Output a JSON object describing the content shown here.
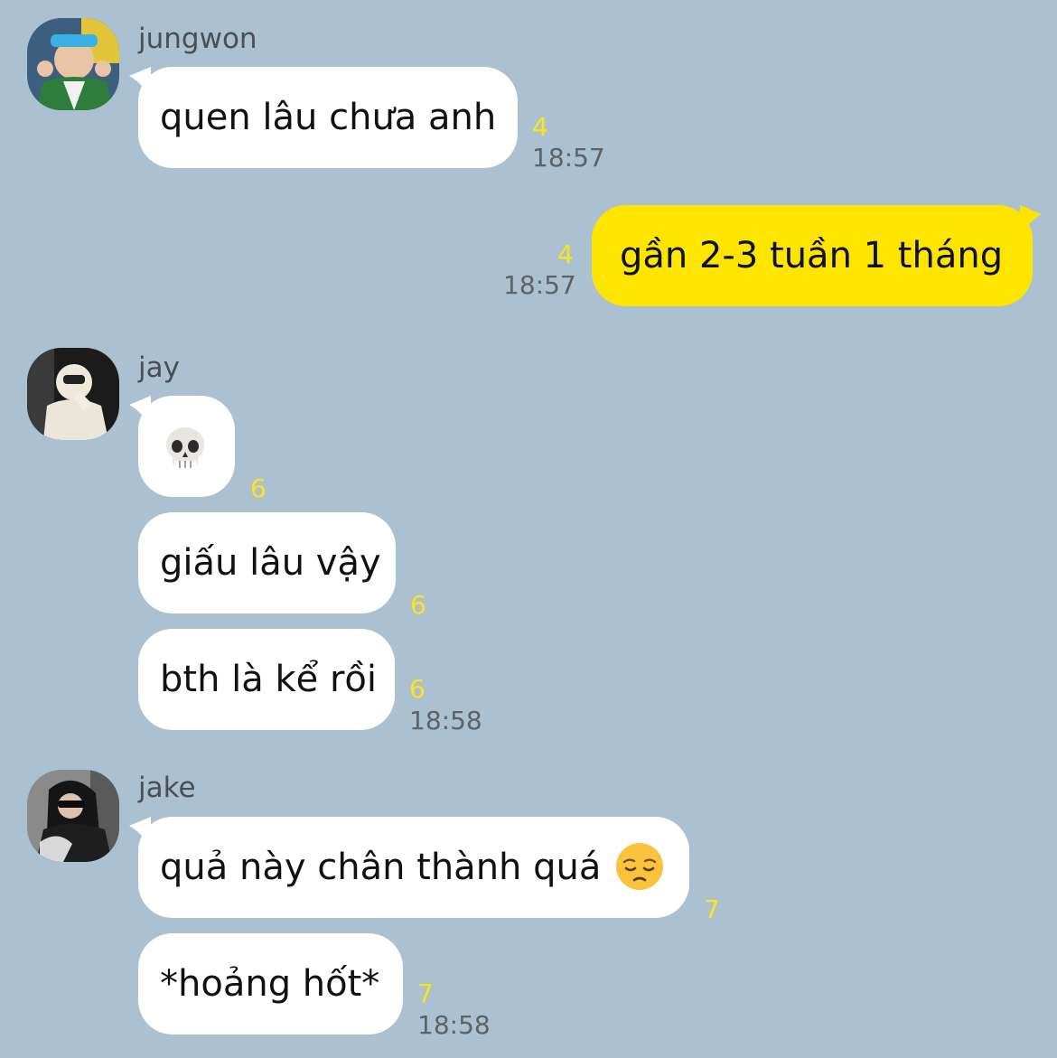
{
  "chat": {
    "messages": [
      {
        "sender": "jungwon",
        "text": "quen lâu chưa anh",
        "unread": "4",
        "time": "18:57"
      },
      {
        "sender": "me",
        "text": "gần 2-3 tuần 1 tháng",
        "unread": "4",
        "time": "18:57"
      },
      {
        "sender": "jay",
        "emoji": "skull-emoji",
        "unread": "6"
      },
      {
        "sender": "jay",
        "text": "giấu lâu vậy",
        "unread": "6"
      },
      {
        "sender": "jay",
        "text": "bth là kể rồi",
        "unread": "6",
        "time": "18:58"
      },
      {
        "sender": "jake",
        "text": "quả này chân thành quá",
        "emoji": "pensive-face-emoji",
        "unread": "7"
      },
      {
        "sender": "jake",
        "text": "*hoảng hốt*",
        "unread": "7",
        "time": "18:58"
      }
    ]
  },
  "colors": {
    "background": "#abc1d2",
    "incoming_bubble": "#ffffff",
    "outgoing_bubble": "#fee500",
    "unread_count": "#fbe419",
    "timestamp": "#5b6268"
  }
}
